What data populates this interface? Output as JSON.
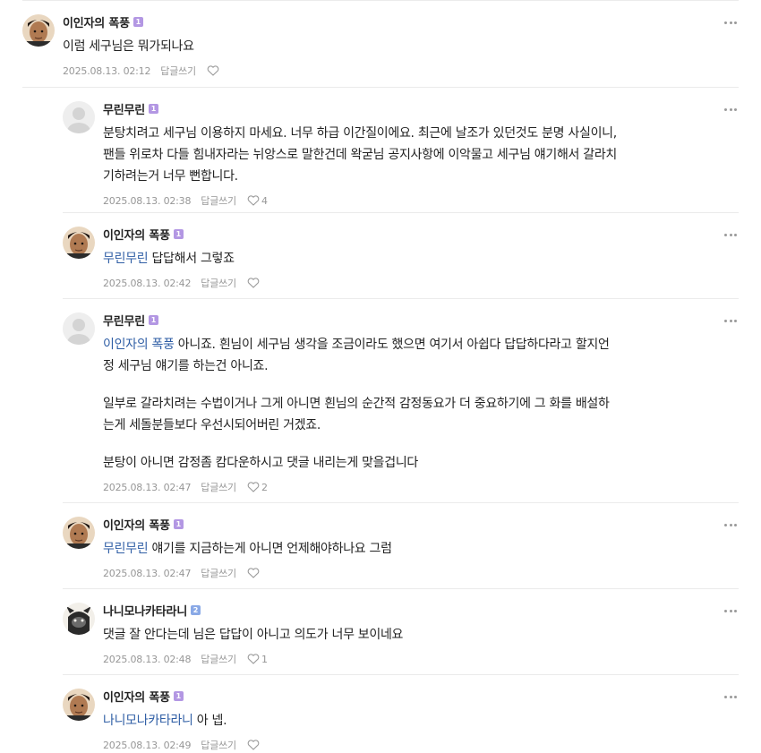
{
  "comments": [
    {
      "nick": "이인자의 폭풍",
      "level": "1",
      "lines": [
        "이럼 세구님은 뭐가되나요"
      ],
      "date": "2025.08.13. 02:12",
      "reply_label": "답글쓰기",
      "likes": ""
    },
    {
      "nick": "무린무린",
      "level": "1",
      "lines": [
        "분탕치려고 세구님 이용하지 마세요. 너무 하급 이간질이에요. 최근에 날조가 있던것도 분명 사실이니,",
        "팬들 위로차 다들 힘내자라는 뉘앙스로 말한건데 왁굳님 공지사항에 이악물고 세구님 얘기해서 갈라치",
        "기하려는거 너무 뻔합니다."
      ],
      "date": "2025.08.13. 02:38",
      "reply_label": "답글쓰기",
      "likes": "4"
    },
    {
      "nick": "이인자의 폭풍",
      "level": "1",
      "mention": "무린무린",
      "lines": [
        " 답답해서 그렇죠"
      ],
      "date": "2025.08.13. 02:42",
      "reply_label": "답글쓰기",
      "likes": ""
    },
    {
      "nick": "무린무린",
      "level": "1",
      "mention": "이인자의 폭풍",
      "lines": [
        " 아니죠. 흰님이 세구님 생각을 조금이라도 했으면 여기서 아쉽다 답답하다라고 할지언",
        "정 세구님 얘기를 하는건 아니죠."
      ],
      "para2": [
        "일부로 갈라치려는 수법이거나 그게 아니면 흰님의 순간적 감정동요가 더 중요하기에 그 화를 배설하",
        "는게 세돌분들보다 우선시되어버린 거겠죠."
      ],
      "para3": [
        "분탕이 아니면 감정좀 캄다운하시고 댓글 내리는게 맞을겁니다"
      ],
      "date": "2025.08.13. 02:47",
      "reply_label": "답글쓰기",
      "likes": "2"
    },
    {
      "nick": "이인자의 폭풍",
      "level": "1",
      "mention": "무린무린",
      "lines": [
        " 얘기를 지금하는게 아니면 언제해야하나요 그럼"
      ],
      "date": "2025.08.13. 02:47",
      "reply_label": "답글쓰기",
      "likes": ""
    },
    {
      "nick": "나니모나카타라니",
      "level": "2",
      "lines": [
        "댓글 잘 안다는데 님은 답답이 아니고 의도가 너무 보이네요"
      ],
      "date": "2025.08.13. 02:48",
      "reply_label": "답글쓰기",
      "likes": "1"
    },
    {
      "nick": "이인자의 폭풍",
      "level": "1",
      "mention": "나니모나카타라니",
      "lines": [
        " 아 넵."
      ],
      "date": "2025.08.13. 02:49",
      "reply_label": "답글쓰기",
      "likes": ""
    }
  ],
  "colors": {
    "mention": "#2f5ea5",
    "level1": "#b397e3",
    "level2": "#8aa9e6",
    "meta": "#979797",
    "divider": "#ebebeb"
  },
  "icons": {
    "more": "more-dots-icon",
    "like": "heart-outline-icon"
  }
}
